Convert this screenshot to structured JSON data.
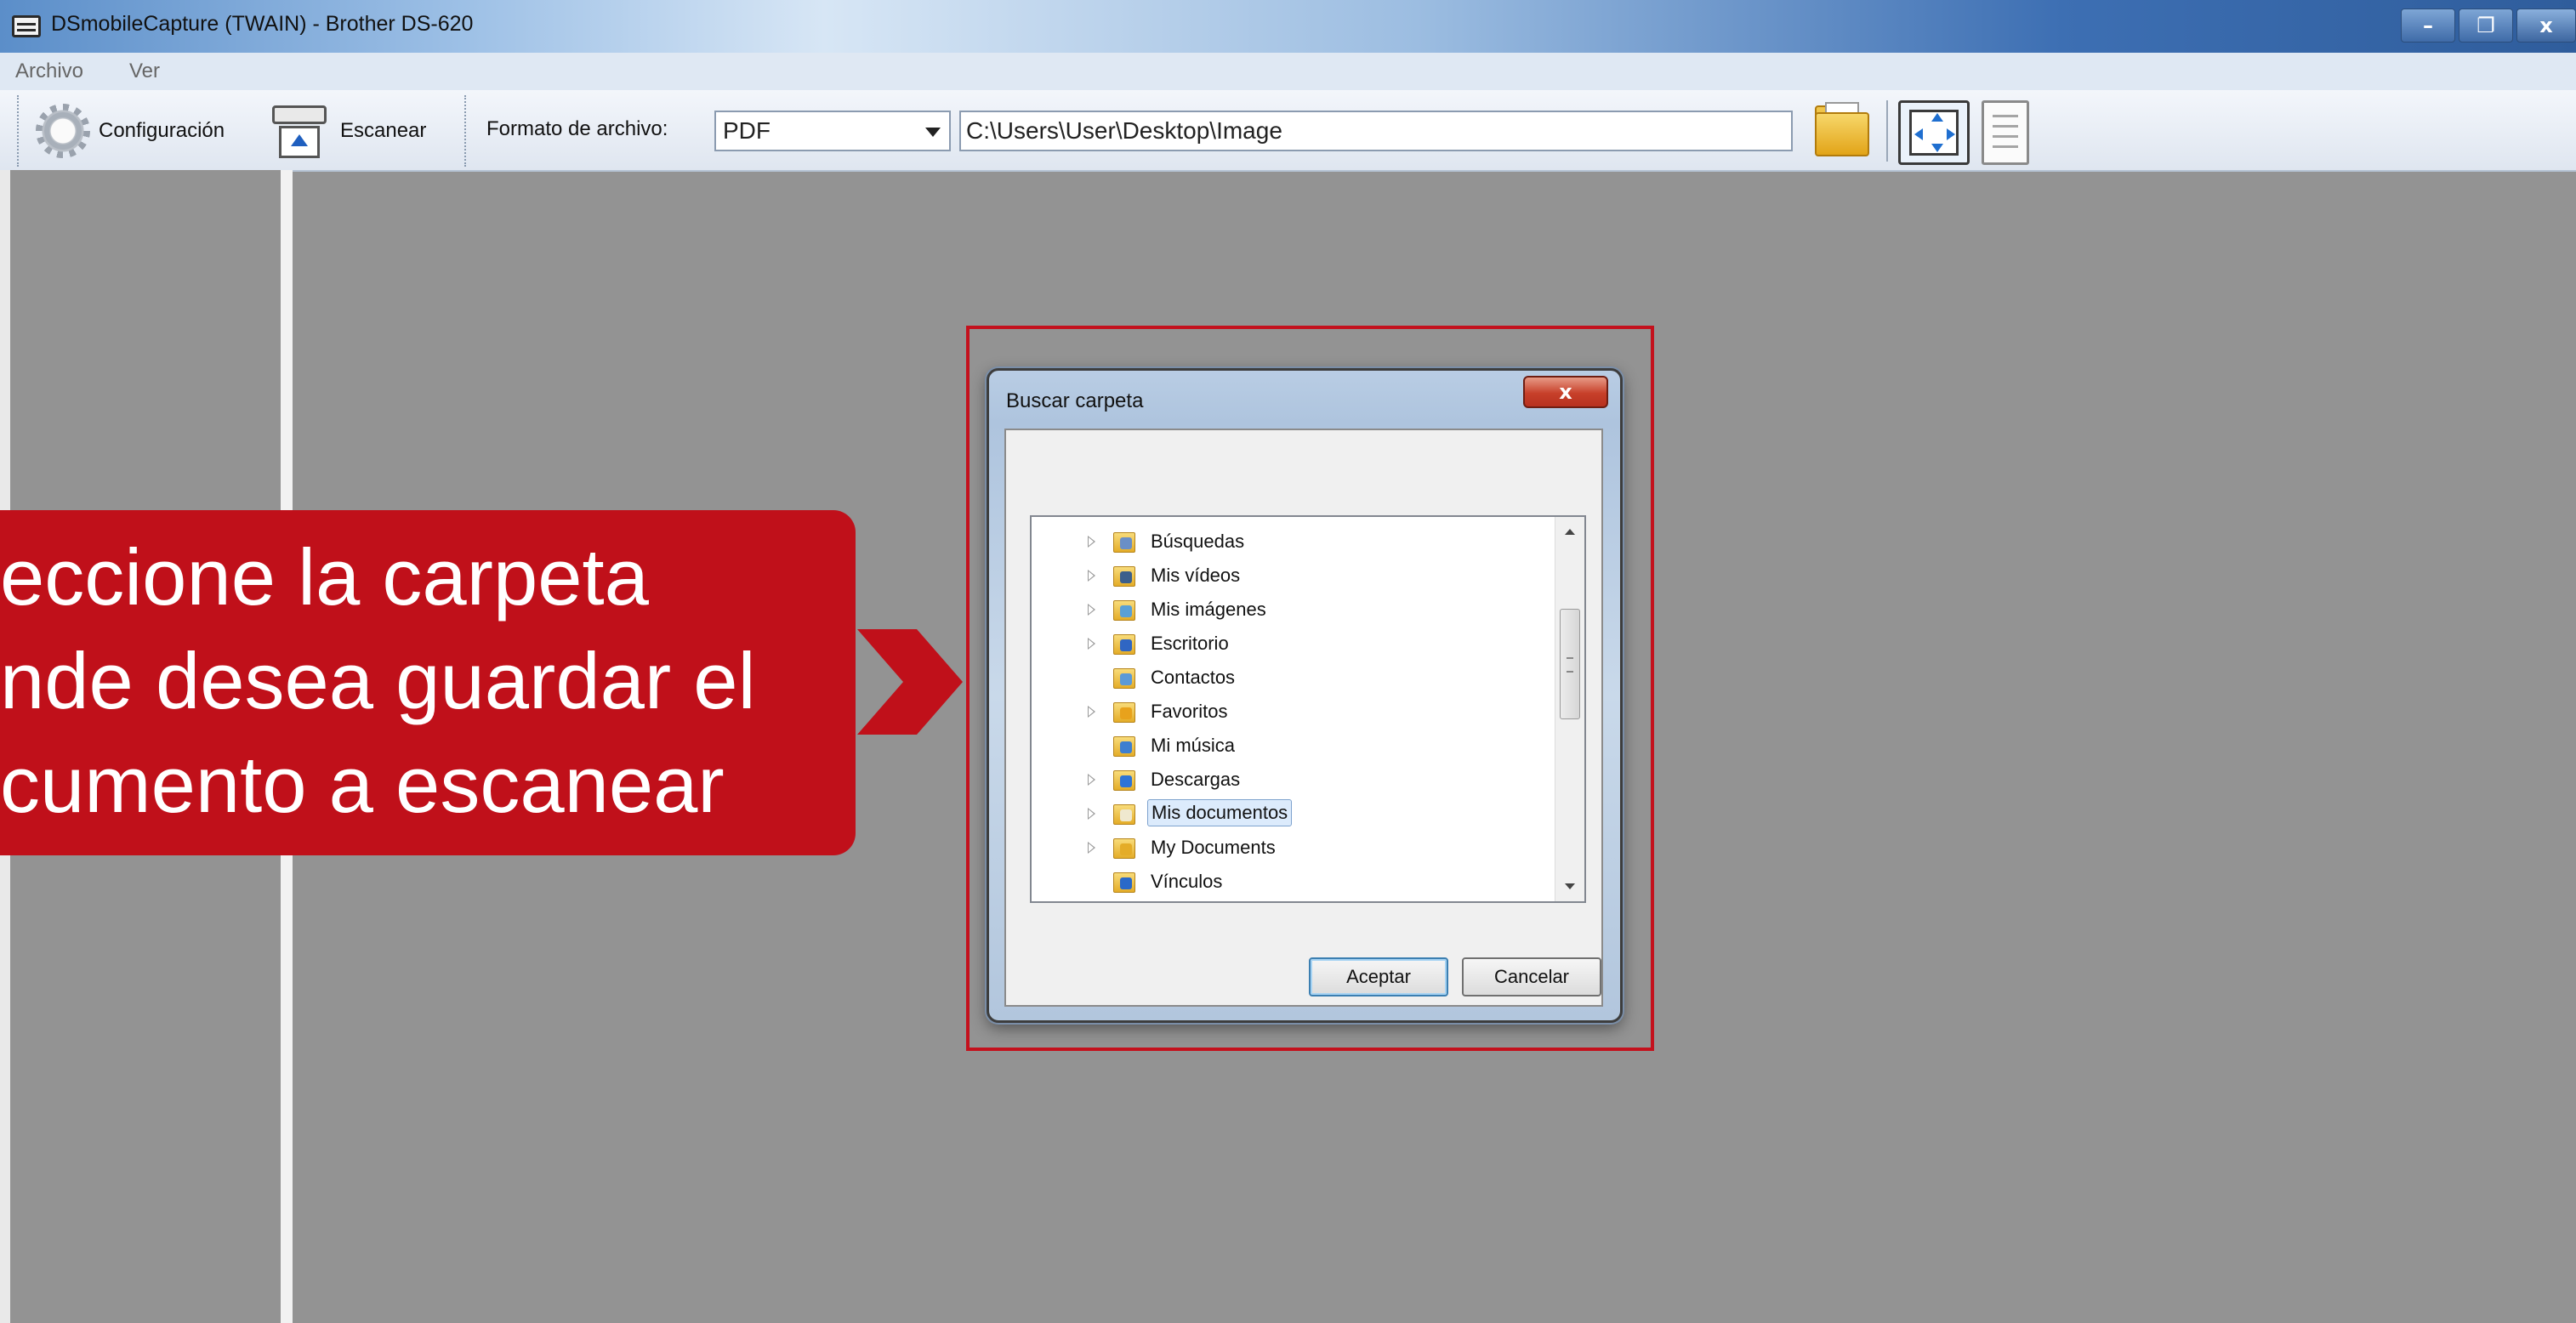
{
  "window": {
    "title": "DSmobileCapture (TWAIN) - Brother DS-620",
    "minimize": "–",
    "restore": "❐",
    "close": "x"
  },
  "menu": {
    "items": [
      "Archivo",
      "Ver"
    ]
  },
  "toolbar": {
    "config_label": "Configuración",
    "scan_label": "Escanear",
    "format_label": "Formato de archivo:",
    "format_value": "PDF",
    "path_value": "C:\\Users\\User\\Desktop\\Image"
  },
  "callout": {
    "lines": [
      "eccione la carpeta",
      "nde desea guardar el",
      "cumento a escanear"
    ],
    "color": "#c0101a"
  },
  "dialog": {
    "title": "Buscar carpeta",
    "close": "x",
    "ok_label": "Aceptar",
    "cancel_label": "Cancelar",
    "tree": [
      {
        "label": "Búsquedas",
        "icon": "search-folder-icon",
        "expander": true,
        "selected": false
      },
      {
        "label": "Mis vídeos",
        "icon": "videos-folder-icon",
        "expander": true,
        "selected": false
      },
      {
        "label": "Mis imágenes",
        "icon": "pictures-folder-icon",
        "expander": true,
        "selected": false
      },
      {
        "label": "Escritorio",
        "icon": "desktop-folder-icon",
        "expander": true,
        "selected": false
      },
      {
        "label": "Contactos",
        "icon": "contacts-folder-icon",
        "expander": false,
        "selected": false
      },
      {
        "label": "Favoritos",
        "icon": "favorites-folder-icon",
        "expander": true,
        "selected": false
      },
      {
        "label": "Mi música",
        "icon": "music-folder-icon",
        "expander": false,
        "selected": false
      },
      {
        "label": "Descargas",
        "icon": "downloads-folder-icon",
        "expander": true,
        "selected": false
      },
      {
        "label": "Mis documentos",
        "icon": "documents-folder-icon",
        "expander": true,
        "selected": true
      },
      {
        "label": "My Documents",
        "icon": "folder-icon",
        "expander": true,
        "selected": false
      },
      {
        "label": "Vínculos",
        "icon": "links-folder-icon",
        "expander": false,
        "selected": false
      }
    ]
  }
}
